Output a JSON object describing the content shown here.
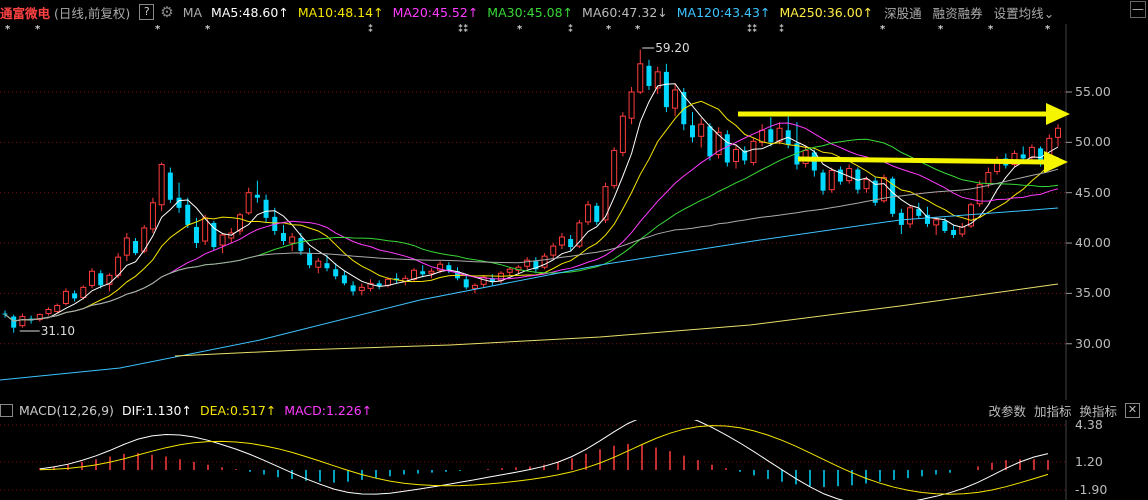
{
  "header": {
    "stock_name": "通富微电",
    "period": "(日线,前复权)",
    "help": "?",
    "ma_label": "MA",
    "ma_items": [
      {
        "text": "MA5:48.60",
        "arrow": "↑",
        "color": "#ffffff"
      },
      {
        "text": "MA10:48.14",
        "arrow": "↑",
        "color": "#f5e500"
      },
      {
        "text": "MA20:45.52",
        "arrow": "↑",
        "color": "#ff3cff"
      },
      {
        "text": "MA30:45.08",
        "arrow": "↑",
        "color": "#38d838"
      },
      {
        "text": "MA60:47.32",
        "arrow": "↓",
        "color": "#bbbbbb"
      },
      {
        "text": "MA120:43.43",
        "arrow": "↑",
        "color": "#3cc4ff"
      },
      {
        "text": "MA250:36.00",
        "arrow": "↑",
        "color": "#ffee44"
      }
    ],
    "menu": [
      "深股通",
      "融资融券",
      "设置均线"
    ],
    "menu_arrow": "⌄",
    "min_btn": "—"
  },
  "markers": [
    {
      "sym": "*"
    },
    {
      "sym": "*"
    },
    {
      "sym": "*"
    },
    {
      "sym": "*"
    },
    {
      "sym": "⁑"
    },
    {
      "sym": "⁑⁑"
    },
    {
      "sym": "*"
    },
    {
      "sym": "⁑"
    },
    {
      "sym": "*"
    },
    {
      "sym": "*"
    },
    {
      "sym": "⁑⁑"
    },
    {
      "sym": "⁑"
    },
    {
      "sym": "*"
    },
    {
      "sym": "*"
    },
    {
      "sym": "*"
    },
    {
      "sym": "*"
    }
  ],
  "price_axis": [
    "55.00",
    "50.00",
    "45.00",
    "40.00",
    "35.00",
    "30.00"
  ],
  "annotations": {
    "high": "59.20",
    "low": "31.10"
  },
  "macd": {
    "label": "MACD(12,26,9)",
    "dif": "DIF:1.130",
    "dif_arrow": "↑",
    "dea": "DEA:0.517",
    "dea_arrow": "↑",
    "macd": "MACD:1.226",
    "macd_arrow": "↑",
    "buttons": [
      "改参数",
      "加指标",
      "换指标"
    ],
    "close": "✕",
    "axis": [
      "4.38",
      "1.20",
      "-1.90"
    ]
  },
  "colors": {
    "up": "#ff3c3c",
    "down": "#00d8ff",
    "arrow": "#f5f500",
    "bg": "#000000"
  },
  "chart_data": {
    "type": "candlestick",
    "y_range": [
      27,
      60
    ],
    "candles": [
      [
        33.0,
        33.3,
        32.6,
        32.9
      ],
      [
        32.7,
        32.9,
        31.1,
        31.6
      ],
      [
        31.8,
        33.0,
        31.6,
        32.7
      ],
      [
        32.5,
        32.8,
        32.0,
        32.3
      ],
      [
        32.4,
        33.0,
        32.2,
        32.9
      ],
      [
        33.0,
        33.6,
        32.8,
        33.4
      ],
      [
        33.2,
        34.0,
        33.0,
        33.8
      ],
      [
        34.0,
        35.5,
        33.8,
        35.2
      ],
      [
        35.0,
        35.3,
        34.2,
        34.5
      ],
      [
        34.6,
        35.8,
        34.4,
        35.6
      ],
      [
        35.8,
        37.5,
        35.5,
        37.2
      ],
      [
        37.0,
        37.3,
        35.5,
        35.8
      ],
      [
        35.9,
        37.0,
        35.2,
        36.8
      ],
      [
        36.8,
        39.0,
        36.5,
        38.6
      ],
      [
        38.8,
        41.0,
        38.2,
        40.5
      ],
      [
        40.2,
        40.5,
        38.8,
        39.0
      ],
      [
        39.2,
        41.8,
        39.0,
        41.5
      ],
      [
        41.4,
        44.5,
        41.0,
        44.0
      ],
      [
        43.8,
        48.0,
        43.2,
        47.8
      ],
      [
        47.0,
        47.5,
        44.0,
        44.3
      ],
      [
        44.5,
        46.0,
        43.0,
        43.5
      ],
      [
        43.8,
        44.5,
        41.5,
        41.8
      ],
      [
        41.6,
        42.5,
        39.5,
        40.0
      ],
      [
        40.2,
        42.8,
        39.8,
        42.5
      ],
      [
        42.0,
        42.2,
        39.3,
        39.6
      ],
      [
        39.8,
        41.0,
        39.0,
        40.8
      ],
      [
        40.5,
        41.5,
        40.0,
        41.0
      ],
      [
        41.2,
        43.0,
        40.8,
        42.8
      ],
      [
        43.0,
        45.5,
        42.8,
        45.0
      ],
      [
        44.8,
        46.2,
        44.0,
        44.5
      ],
      [
        44.3,
        44.8,
        42.0,
        42.5
      ],
      [
        42.6,
        43.5,
        40.8,
        41.2
      ],
      [
        41.0,
        41.8,
        39.8,
        40.2
      ],
      [
        40.0,
        41.0,
        39.2,
        40.6
      ],
      [
        40.5,
        41.0,
        38.8,
        39.2
      ],
      [
        39.0,
        39.5,
        37.5,
        37.8
      ],
      [
        37.6,
        38.5,
        37.0,
        38.2
      ],
      [
        38.0,
        38.8,
        37.2,
        37.5
      ],
      [
        37.4,
        38.0,
        36.4,
        36.7
      ],
      [
        36.8,
        37.2,
        35.8,
        36.0
      ],
      [
        35.8,
        36.2,
        34.8,
        35.2
      ],
      [
        35.3,
        36.0,
        34.8,
        35.6
      ],
      [
        35.5,
        36.4,
        35.2,
        36.0
      ],
      [
        36.0,
        36.3,
        35.4,
        35.7
      ],
      [
        35.8,
        36.6,
        35.6,
        36.4
      ],
      [
        36.5,
        37.0,
        36.0,
        36.3
      ],
      [
        36.2,
        36.8,
        35.8,
        36.5
      ],
      [
        36.4,
        37.5,
        36.2,
        37.3
      ],
      [
        37.2,
        37.8,
        36.6,
        36.9
      ],
      [
        37.0,
        37.5,
        36.5,
        37.2
      ],
      [
        37.3,
        38.2,
        37.0,
        37.9
      ],
      [
        37.8,
        38.1,
        37.0,
        37.3
      ],
      [
        37.2,
        37.6,
        36.3,
        36.5
      ],
      [
        36.4,
        36.8,
        35.4,
        35.6
      ],
      [
        35.5,
        36.0,
        35.0,
        35.8
      ],
      [
        35.9,
        36.8,
        35.6,
        36.6
      ],
      [
        36.5,
        36.9,
        35.8,
        36.2
      ],
      [
        36.3,
        37.2,
        36.0,
        37.0
      ],
      [
        37.1,
        37.6,
        36.8,
        37.4
      ],
      [
        37.3,
        37.8,
        36.9,
        37.6
      ],
      [
        37.7,
        38.6,
        37.4,
        38.3
      ],
      [
        38.2,
        38.6,
        37.0,
        37.4
      ],
      [
        37.6,
        39.0,
        37.4,
        38.7
      ],
      [
        38.8,
        40.0,
        38.5,
        39.7
      ],
      [
        39.8,
        41.0,
        39.4,
        40.6
      ],
      [
        40.4,
        40.8,
        39.2,
        39.6
      ],
      [
        39.7,
        42.3,
        39.5,
        42.0
      ],
      [
        42.1,
        44.2,
        41.8,
        43.8
      ],
      [
        43.7,
        44.0,
        41.8,
        42.1
      ],
      [
        42.3,
        46.0,
        42.0,
        45.6
      ],
      [
        45.7,
        49.5,
        45.4,
        49.2
      ],
      [
        49.0,
        53.0,
        48.6,
        52.6
      ],
      [
        52.4,
        55.5,
        51.8,
        55.0
      ],
      [
        55.0,
        59.2,
        54.8,
        57.8
      ],
      [
        57.6,
        58.2,
        55.2,
        55.6
      ],
      [
        55.4,
        57.5,
        54.8,
        57.0
      ],
      [
        57.0,
        57.8,
        53.0,
        53.5
      ],
      [
        53.4,
        55.8,
        52.6,
        55.2
      ],
      [
        55.0,
        55.4,
        51.2,
        51.8
      ],
      [
        51.7,
        53.0,
        50.0,
        50.5
      ],
      [
        50.6,
        52.4,
        49.5,
        51.8
      ],
      [
        51.6,
        51.9,
        48.2,
        48.6
      ],
      [
        48.8,
        51.5,
        48.4,
        51.0
      ],
      [
        50.8,
        51.2,
        47.6,
        48.0
      ],
      [
        48.1,
        49.8,
        47.4,
        49.3
      ],
      [
        49.2,
        49.6,
        47.8,
        48.2
      ],
      [
        48.0,
        50.5,
        47.7,
        50.1
      ],
      [
        50.0,
        51.8,
        49.6,
        51.2
      ],
      [
        51.3,
        52.5,
        49.6,
        50.0
      ],
      [
        50.1,
        52.0,
        49.8,
        51.4
      ],
      [
        51.2,
        52.6,
        49.4,
        49.8
      ],
      [
        49.9,
        52.0,
        47.3,
        47.8
      ],
      [
        47.9,
        49.6,
        47.5,
        49.2
      ],
      [
        49.0,
        49.3,
        46.6,
        47.2
      ],
      [
        47.0,
        47.3,
        44.8,
        45.2
      ],
      [
        45.3,
        47.5,
        45.0,
        47.2
      ],
      [
        47.3,
        47.6,
        45.8,
        46.1
      ],
      [
        46.2,
        47.8,
        45.9,
        47.4
      ],
      [
        47.3,
        47.5,
        44.9,
        45.3
      ],
      [
        45.4,
        46.6,
        45.0,
        46.3
      ],
      [
        46.2,
        46.5,
        43.7,
        44.0
      ],
      [
        44.2,
        46.8,
        44.0,
        46.5
      ],
      [
        46.4,
        46.6,
        42.6,
        42.9
      ],
      [
        43.0,
        43.4,
        40.9,
        41.8
      ],
      [
        41.9,
        43.8,
        41.5,
        43.5
      ],
      [
        43.4,
        44.0,
        42.4,
        42.7
      ],
      [
        42.8,
        43.6,
        41.6,
        41.9
      ],
      [
        41.8,
        42.6,
        40.8,
        42.3
      ],
      [
        42.2,
        42.5,
        41.0,
        41.2
      ],
      [
        41.3,
        41.8,
        40.5,
        40.8
      ],
      [
        40.9,
        42.0,
        40.6,
        41.6
      ],
      [
        41.7,
        44.0,
        41.5,
        43.8
      ],
      [
        43.9,
        46.2,
        43.6,
        45.8
      ],
      [
        45.9,
        47.5,
        45.5,
        47.0
      ],
      [
        47.1,
        48.6,
        46.8,
        48.3
      ],
      [
        48.4,
        48.9,
        47.4,
        47.7
      ],
      [
        47.8,
        49.2,
        47.6,
        48.9
      ],
      [
        48.8,
        49.6,
        48.0,
        48.4
      ],
      [
        48.5,
        49.8,
        48.2,
        49.5
      ],
      [
        49.4,
        49.6,
        47.6,
        48.0
      ],
      [
        48.1,
        50.8,
        47.9,
        50.4
      ],
      [
        50.5,
        51.8,
        49.6,
        51.4
      ]
    ],
    "macd_hist": [
      0.2,
      0.4,
      0.6,
      0.9,
      1.2,
      1.5,
      1.8,
      1.9,
      1.7,
      1.5,
      1.2,
      0.9,
      0.6,
      0.3,
      0.1,
      -0.2,
      -0.5,
      -0.8,
      -1.0,
      -1.2,
      -1.3,
      -1.4,
      -1.3,
      -1.1,
      -0.9,
      -0.7,
      -0.5,
      -0.4,
      -0.3,
      -0.2,
      -0.1,
      0.0,
      0.1,
      0.2,
      0.3,
      0.4,
      0.6,
      0.9,
      1.3,
      1.8,
      2.3,
      2.7,
      2.9,
      2.8,
      2.5,
      2.1,
      1.6,
      1.1,
      0.6,
      0.2,
      -0.2,
      -0.6,
      -1.0,
      -1.3,
      -1.6,
      -1.8,
      -1.9,
      -1.8,
      -1.7,
      -1.5,
      -1.3,
      -1.1,
      -0.9,
      -0.7,
      -0.5,
      -0.3,
      0.0,
      0.4,
      0.8,
      1.1,
      1.2,
      1.2,
      1.1
    ]
  }
}
